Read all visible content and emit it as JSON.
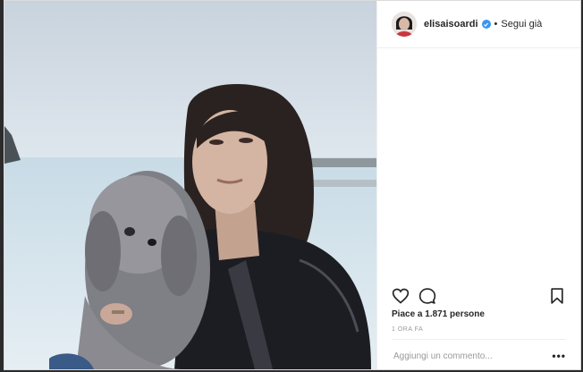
{
  "header": {
    "username": "elisaisoardi",
    "separator": "•",
    "follow_label": "Segui già"
  },
  "likes": {
    "text": "Piace a 1.871 persone"
  },
  "time": {
    "text": "1 ORA FA"
  },
  "comment": {
    "placeholder": "Aggiungi un commento..."
  },
  "more": {
    "label": "•••"
  },
  "colors": {
    "verified": "#3897f0",
    "text": "#262626",
    "muted": "#999999"
  },
  "icons": [
    "heart-icon",
    "comment-icon",
    "bookmark-icon",
    "more-icon",
    "verified-icon"
  ]
}
